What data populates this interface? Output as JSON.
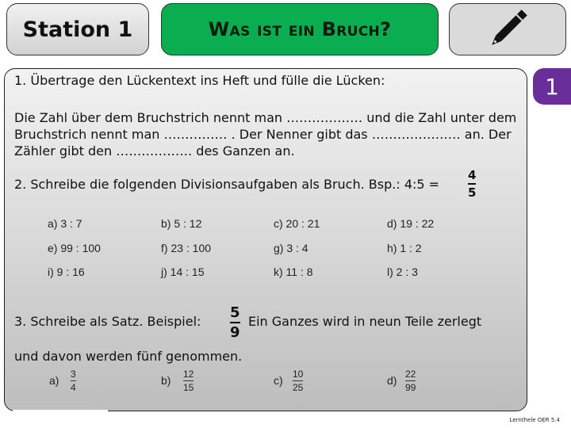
{
  "header": {
    "station": "Station 1",
    "title": "Was ist ein Bruch?",
    "icon": "pencil-icon"
  },
  "badge": {
    "number": "1",
    "color": "#6a2e9a"
  },
  "colors": {
    "title_bg": "#0aad4f",
    "badge_bg": "#6a2e9a"
  },
  "task1": {
    "heading": "1.  Übertrage den Lückentext ins Heft und fülle die Lücken:",
    "lines": [
      "Die Zahl über dem Bruchstrich nennt man ……………… und die Zahl unter dem",
      "Bruchstrich nennt man …………… . Der Nenner gibt das ………………… an. Der",
      "Zähler gibt den ……………… des Ganzen an."
    ]
  },
  "task2": {
    "heading": "2.   Schreibe die folgenden Divisionsaufgaben als Bruch.   Bsp.: 4:5 =",
    "example_fraction": {
      "numerator": "4",
      "denominator": "5"
    },
    "exercises": [
      [
        "a) 3 : 7",
        "b) 5 : 12",
        "c)  20 : 21",
        "d) 19 : 22"
      ],
      [
        "e) 99 : 100",
        "f) 23 : 100",
        "g)  3 : 4",
        "h) 1 : 2"
      ],
      [
        "i)  9 : 16",
        "j) 14 : 15",
        "k)  11 : 8",
        "l) 2 : 3"
      ]
    ]
  },
  "task3": {
    "heading": "3.  Schreibe als Satz. Beispiel:",
    "example_fraction": {
      "numerator": "5",
      "denominator": "9"
    },
    "example_text": "Ein Ganzes wird in neun Teile zerlegt",
    "example_text_cont": "und davon werden fünf genommen.",
    "exercises": [
      {
        "label": "a)",
        "numerator": "3",
        "denominator": "4"
      },
      {
        "label": "b)",
        "numerator": "12",
        "denominator": "15"
      },
      {
        "label": "c)",
        "numerator": "10",
        "denominator": "25"
      },
      {
        "label": "d)",
        "numerator": "22",
        "denominator": "99"
      }
    ]
  },
  "footer": "Lernthele OER 5.4"
}
